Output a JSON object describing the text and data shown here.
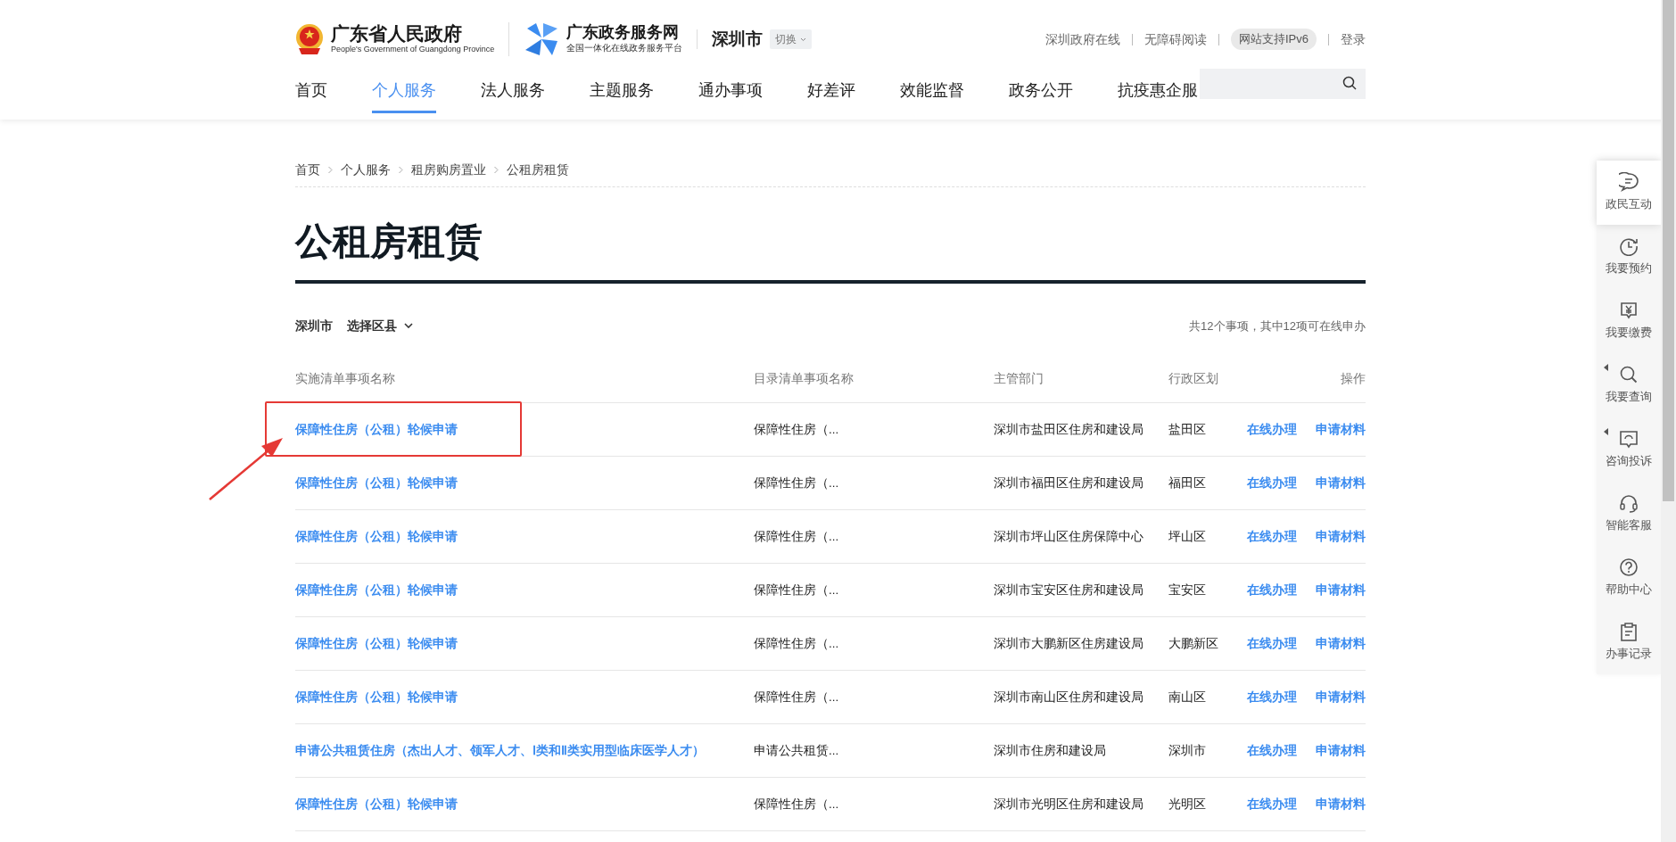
{
  "header": {
    "gov_title": "广东省人民政府",
    "gov_subtitle": "People's Government of Guangdong Province",
    "portal_title": "广东政务服务网",
    "portal_subtitle": "全国一体化在线政务服务平台",
    "city": "深圳市",
    "switch_label": "切换"
  },
  "top_links": [
    {
      "label": "深圳政府在线",
      "kind": "link"
    },
    {
      "label": "无障碍阅读",
      "kind": "link"
    },
    {
      "label": "网站支持IPv6",
      "kind": "pill"
    },
    {
      "label": "登录",
      "kind": "link"
    }
  ],
  "nav": [
    {
      "label": "首页",
      "selected": false
    },
    {
      "label": "个人服务",
      "selected": true
    },
    {
      "label": "法人服务",
      "selected": false
    },
    {
      "label": "主题服务",
      "selected": false
    },
    {
      "label": "通办事项",
      "selected": false
    },
    {
      "label": "好差评",
      "selected": false
    },
    {
      "label": "效能监督",
      "selected": false
    },
    {
      "label": "政务公开",
      "selected": false
    },
    {
      "label": "抗疫惠企服",
      "selected": false
    }
  ],
  "breadcrumb": [
    "首页",
    "个人服务",
    "租房购房置业",
    "公租房租赁"
  ],
  "page_title": "公租房租赁",
  "filter": {
    "city": "深圳市",
    "district_label": "选择区县"
  },
  "summary": "共12个事项，其中12项可在线申办",
  "table": {
    "columns": [
      "实施清单事项名称",
      "目录清单事项名称",
      "主管部门",
      "行政区划",
      "操作"
    ],
    "rows": [
      {
        "name": "保障性住房（公租）轮候申请",
        "catalog": "保障性住房（...",
        "department": "深圳市盐田区住房和建设局",
        "region": "盐田区",
        "actions": [
          "在线办理",
          "申请材料"
        ],
        "highlighted": true
      },
      {
        "name": "保障性住房（公租）轮候申请",
        "catalog": "保障性住房（...",
        "department": "深圳市福田区住房和建设局",
        "region": "福田区",
        "actions": [
          "在线办理",
          "申请材料"
        ],
        "highlighted": false
      },
      {
        "name": "保障性住房（公租）轮候申请",
        "catalog": "保障性住房（...",
        "department": "深圳市坪山区住房保障中心",
        "region": "坪山区",
        "actions": [
          "在线办理",
          "申请材料"
        ],
        "highlighted": false
      },
      {
        "name": "保障性住房（公租）轮候申请",
        "catalog": "保障性住房（...",
        "department": "深圳市宝安区住房和建设局",
        "region": "宝安区",
        "actions": [
          "在线办理",
          "申请材料"
        ],
        "highlighted": false
      },
      {
        "name": "保障性住房（公租）轮候申请",
        "catalog": "保障性住房（...",
        "department": "深圳市大鹏新区住房建设局",
        "region": "大鹏新区",
        "actions": [
          "在线办理",
          "申请材料"
        ],
        "highlighted": false
      },
      {
        "name": "保障性住房（公租）轮候申请",
        "catalog": "保障性住房（...",
        "department": "深圳市南山区住房和建设局",
        "region": "南山区",
        "actions": [
          "在线办理",
          "申请材料"
        ],
        "highlighted": false
      },
      {
        "name": "申请公共租赁住房（杰出人才、领军人才、Ⅰ类和Ⅱ类实用型临床医学人才）",
        "catalog": "申请公共租赁...",
        "department": "深圳市住房和建设局",
        "region": "深圳市",
        "actions": [
          "在线办理",
          "申请材料"
        ],
        "highlighted": false
      },
      {
        "name": "保障性住房（公租）轮候申请",
        "catalog": "保障性住房（...",
        "department": "深圳市光明区住房和建设局",
        "region": "光明区",
        "actions": [
          "在线办理",
          "申请材料"
        ],
        "highlighted": false
      }
    ]
  },
  "side_tools": [
    {
      "label": "政民互动",
      "kind": "chat",
      "selected": true,
      "has_flyout": false
    },
    {
      "label": "我要预约",
      "kind": "clock",
      "selected": false,
      "has_flyout": false
    },
    {
      "label": "我要缴费",
      "kind": "yen",
      "selected": false,
      "has_flyout": false
    },
    {
      "label": "我要查询",
      "kind": "search",
      "selected": false,
      "has_flyout": true
    },
    {
      "label": "咨询投诉",
      "kind": "message",
      "selected": false,
      "has_flyout": true
    },
    {
      "label": "智能客服",
      "kind": "headset",
      "selected": false,
      "has_flyout": false
    },
    {
      "label": "帮助中心",
      "kind": "help",
      "selected": false,
      "has_flyout": false
    },
    {
      "label": "办事记录",
      "kind": "clipboard",
      "selected": false,
      "has_flyout": false
    }
  ]
}
